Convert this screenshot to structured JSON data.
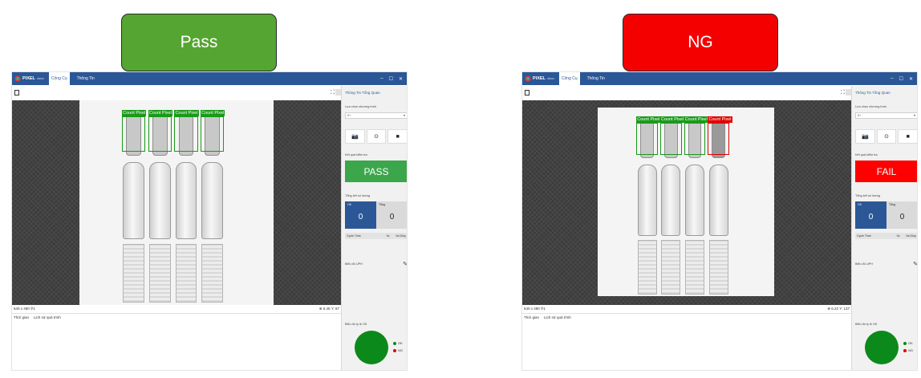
{
  "banners": {
    "pass": {
      "label": "Pass",
      "color": "#55a532"
    },
    "ng": {
      "label": "NG",
      "color": "#f50000"
    }
  },
  "windows": [
    {
      "brand": "PIXEL",
      "brand_sub": "vision",
      "tabs": [
        "Công Cụ",
        "Thông Tin"
      ],
      "window_controls": [
        "–",
        "☐",
        "✕"
      ],
      "panel_title": "Thông Tin Tổng Quan",
      "program_label": "Lựa chọn chương trình",
      "program_value": "0+",
      "result_label": "Kết quả kiểm tra",
      "result": "PASS",
      "result_color": "#3ca64b",
      "count_label": "Tổng kết số lượng",
      "ok_label": "OK",
      "ok_count": "0",
      "total_label": "Tổng",
      "total_count": "0",
      "cycle_label": "Cycle Time",
      "cycle_value": "0s",
      "cycle_rate": "0s/10sp",
      "uph_label": "Biểu đồ UPH",
      "ratio_label": "Biểu đồ tỷ lệ OK",
      "legend": [
        {
          "label": "OK",
          "color": "#0b8a1b"
        },
        {
          "label": "NG",
          "color": "#e00000"
        }
      ],
      "status_left": "640 x 480  ⚲1",
      "status_right": "⊕ 6.45 Y: 87",
      "log_tabs": [
        "Thời gian",
        "Lịch sử quá trình"
      ],
      "detection_label": "Count Pixel",
      "detections": [
        "ok",
        "ok",
        "ok",
        "ok"
      ]
    },
    {
      "brand": "PIXEL",
      "brand_sub": "vision",
      "tabs": [
        "Công Cụ",
        "Thông Tin"
      ],
      "window_controls": [
        "–",
        "☐",
        "✕"
      ],
      "panel_title": "Thông Tin Tổng Quan",
      "program_label": "Lựa chọn chương trình",
      "program_value": "0+",
      "result_label": "Kết quả kiểm tra",
      "result": "FAIL",
      "result_color": "#ff0000",
      "count_label": "Tổng kết số lượng",
      "ok_label": "OK",
      "ok_count": "0",
      "total_label": "Tổng",
      "total_count": "0",
      "cycle_label": "Cycle Time",
      "cycle_value": "0s",
      "cycle_rate": "0s/10sp",
      "uph_label": "Biểu đồ UPH",
      "ratio_label": "Biểu đồ tỷ lệ OK",
      "legend": [
        {
          "label": "OK",
          "color": "#0b8a1b"
        },
        {
          "label": "NG",
          "color": "#e00000"
        }
      ],
      "status_left": "640 x 480  ⚲1",
      "status_right": "⊕ 6.22 Y: 137",
      "log_tabs": [
        "Thời gian",
        "Lịch sử quá trình"
      ],
      "detection_label": "Count Pixel",
      "detections": [
        "ok",
        "ok",
        "ok",
        "ng"
      ]
    }
  ]
}
